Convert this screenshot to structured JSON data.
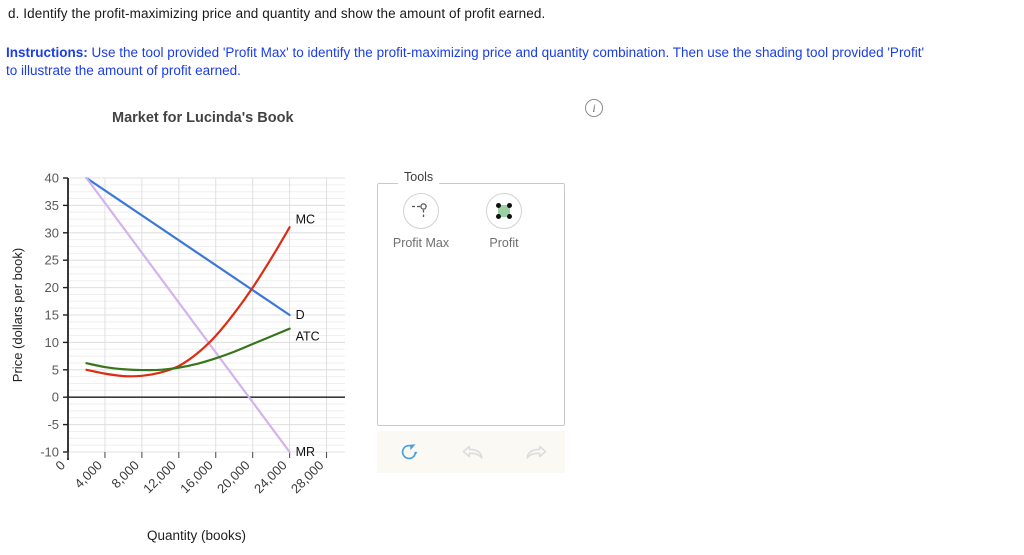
{
  "question": {
    "text": "d. Identify the profit-maximizing price and quantity and show the amount of profit earned."
  },
  "instructions": {
    "label": "Instructions:",
    "body": " Use the tool provided 'Profit Max' to identify the profit-maximizing price and quantity combination. Then use the shading tool provided 'Profit' to illustrate the amount of profit earned."
  },
  "info_icon": {
    "glyph": "i",
    "name": "info-icon"
  },
  "tools": {
    "legend": "Tools",
    "items": [
      {
        "label": "Profit Max",
        "icon": "profit-max-icon"
      },
      {
        "label": "Profit",
        "icon": "profit-shade-icon"
      }
    ]
  },
  "action_bar": {
    "buttons": [
      {
        "name": "reset-icon",
        "label": "Reset",
        "color": "#4a9ede"
      },
      {
        "name": "undo-arrow-icon",
        "label": "Undo",
        "color": "#dcdcdc"
      },
      {
        "name": "redo-arrow-icon",
        "label": "Redo",
        "color": "#dcdcdc"
      }
    ]
  },
  "chart_data": {
    "type": "line",
    "title": "Market for Lucinda's Book",
    "xlabel": "Quantity (books)",
    "ylabel": "Price (dollars per book)",
    "xlim": [
      0,
      30000
    ],
    "ylim": [
      -10,
      40
    ],
    "xticks": [
      "0",
      "4,000",
      "8,000",
      "12,000",
      "16,000",
      "20,000",
      "24,000",
      "28,000"
    ],
    "xtick_values": [
      0,
      4000,
      8000,
      12000,
      16000,
      20000,
      24000,
      28000
    ],
    "yticks": [
      "40",
      "35",
      "30",
      "25",
      "20",
      "15",
      "10",
      "5",
      "0",
      "-5",
      "-10"
    ],
    "ytick_values": [
      40,
      35,
      30,
      25,
      20,
      15,
      10,
      5,
      0,
      -5,
      -10
    ],
    "grid": true,
    "minor_grid_step": 1.25,
    "zero_line": 0,
    "legend_position": "inline-end-labels",
    "series": [
      {
        "name": "D",
        "label": "D",
        "color": "#3c78d8",
        "points": [
          [
            2000,
            40
          ],
          [
            24000,
            15
          ]
        ]
      },
      {
        "name": "MR",
        "label": "MR",
        "color": "#d3b3ec",
        "points": [
          [
            2000,
            40
          ],
          [
            24000,
            -10
          ]
        ]
      },
      {
        "name": "MC",
        "label": "MC",
        "color": "#dd2c14",
        "points": [
          [
            2000,
            5.0
          ],
          [
            4000,
            4.3
          ],
          [
            6000,
            3.85
          ],
          [
            8000,
            3.9
          ],
          [
            10000,
            4.5
          ],
          [
            12000,
            5.7
          ],
          [
            14000,
            8.0
          ],
          [
            16000,
            11.2
          ],
          [
            18000,
            15.3
          ],
          [
            20000,
            20.0
          ],
          [
            22000,
            25.3
          ],
          [
            24000,
            31.0
          ]
        ]
      },
      {
        "name": "ATC",
        "label": "ATC",
        "color": "#38761d",
        "points": [
          [
            2000,
            6.2
          ],
          [
            4000,
            5.5
          ],
          [
            6000,
            5.1
          ],
          [
            8000,
            4.95
          ],
          [
            10000,
            5.0
          ],
          [
            12000,
            5.4
          ],
          [
            14000,
            6.1
          ],
          [
            16000,
            7.1
          ],
          [
            18000,
            8.3
          ],
          [
            20000,
            9.7
          ],
          [
            22000,
            11.1
          ],
          [
            24000,
            12.5
          ]
        ]
      }
    ]
  }
}
